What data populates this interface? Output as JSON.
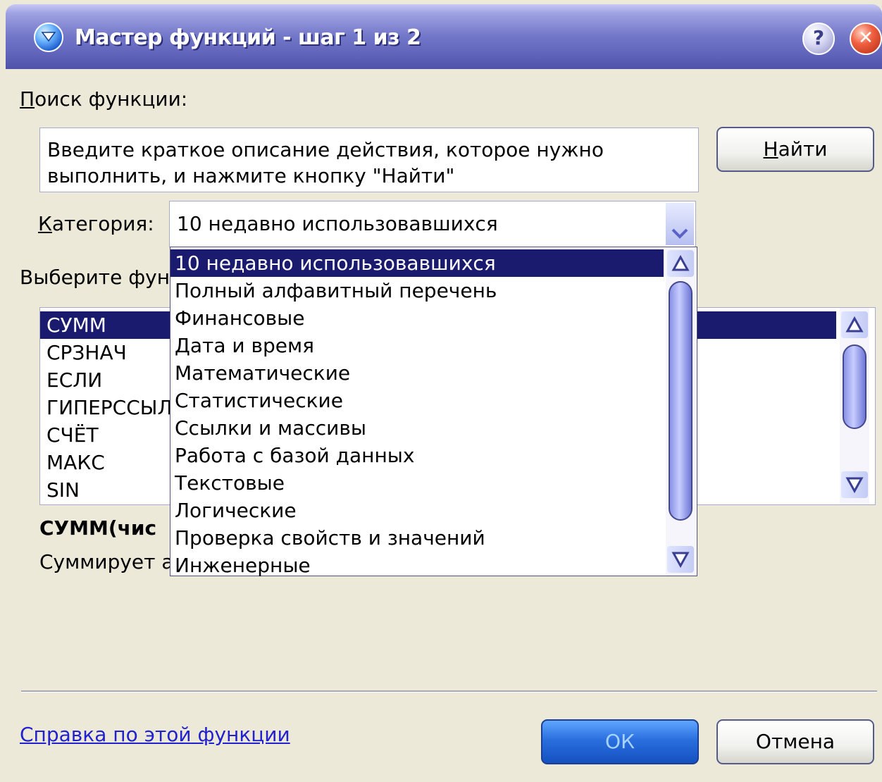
{
  "window": {
    "title": "Мастер функций - шаг 1 из 2",
    "help_button": "?",
    "close_button": "✕"
  },
  "search": {
    "label": "оиск функции:",
    "label_mnemonic": "П",
    "value": "Введите краткое описание действия, которое нужно выполнить, и нажмите кнопку \"Найти\"",
    "find_button_rest": "айти",
    "find_button_mnemonic": "Н"
  },
  "category": {
    "label_mnemonic": "К",
    "label": "атегория:",
    "selected": "10 недавно использовавшихся",
    "options": [
      "10 недавно использовавшихся",
      "Полный алфавитный перечень",
      "Финансовые",
      "Дата и время",
      "Математические",
      "Статистические",
      "Ссылки и массивы",
      "Работа с базой данных",
      "Текстовые",
      "Логические",
      "Проверка свойств и значений",
      "Инженерные"
    ]
  },
  "functions": {
    "label": "Выберите фун",
    "items": [
      "СУММ",
      "СРЗНАЧ",
      "ЕСЛИ",
      "ГИПЕРССЫЛ",
      "СЧЁТ",
      "МАКС",
      "SIN"
    ],
    "selected_index": 0,
    "signature": "СУММ(чис",
    "description": "Суммирует а"
  },
  "footer": {
    "help_link": "Справка по этой функции",
    "ok_button": "ОК",
    "cancel_button": "Отмена"
  },
  "colors": {
    "title_bar": "#6b6fc4",
    "selection": "#1a1a6e",
    "dialog_bg": "#ece9d8",
    "link": "#2222cc",
    "ok_button": "#2a6fde"
  }
}
